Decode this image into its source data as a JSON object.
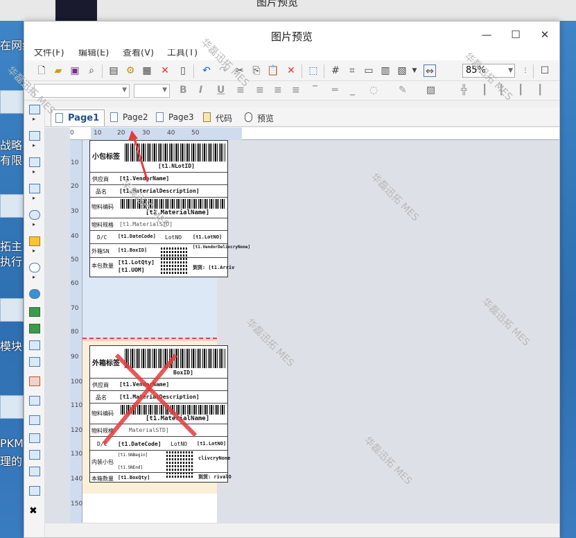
{
  "window": {
    "title": "图片预览",
    "minimize_glyph": "—",
    "maximize_glyph": "☐",
    "close_glyph": "✕"
  },
  "desktop": {
    "behind_title": "图片预览",
    "labels": [
      "在网络",
      "战略",
      "有限",
      "拓主",
      "执行",
      "模块",
      "PKM",
      "理的"
    ]
  },
  "menu": [
    "文件(F)",
    "编辑(E)",
    "查看(V)",
    "工具(T)"
  ],
  "toolbar": {
    "zoom_value": "85%"
  },
  "tabs": [
    {
      "label": "Page1",
      "active": true
    },
    {
      "label": "Page2",
      "active": false
    },
    {
      "label": "Page3",
      "active": false
    },
    {
      "label": "代码",
      "active": false
    },
    {
      "label": "预览",
      "active": false
    }
  ],
  "ruler": {
    "h": [
      "0",
      "10",
      "20",
      "30",
      "40",
      "50"
    ],
    "v": [
      "10",
      "20",
      "30",
      "40",
      "50",
      "60",
      "70",
      "80",
      "90",
      "100",
      "110",
      "120",
      "130",
      "140",
      "150"
    ]
  },
  "label1": {
    "title": "小包标签",
    "lotid_bar": "[t1.NLotID]",
    "vendor_key": "供应商",
    "vendor_val": "[t1.VendorName]",
    "name_key": "品名",
    "name_val": "[t1.MaterialDescription]",
    "code_key": "物料编码",
    "code_val": "[t1.MaterialName]",
    "spec_key": "物料规格",
    "spec_val": "[t1.MaterialSTD]",
    "dc_key": "D/C",
    "dc_val": "[t1.DateCode]",
    "lotno_key": "LotNO",
    "lotno_val": "[t1.LotNO]",
    "sn_key": "外箱SN",
    "sn_val": "[t1.BoxID]",
    "vendor_delivery": "[t1.VendorDelivcryNone]",
    "qty_key": "本包数量",
    "qty_val1": "[t1.LotQty]",
    "qty_val2": "[t1.UOM]",
    "arrive": "到货: [t1.Arriv"
  },
  "label2": {
    "title": "外箱标签",
    "boxid_bar": "BoxID]",
    "vendor_key": "供应商",
    "vendor_val": "[t1.VendorName]",
    "name_key": "品名",
    "name_val": "[t1.MaterialDescription]",
    "code_key": "物料编码",
    "code_val": "[t1.MaterialName]",
    "spec_key": "物料规格",
    "spec_val": "MaterialSTD]",
    "dc_key": "D/C",
    "dc_val": "[t1.DateCode]",
    "lotno_key": "LotNO",
    "lotno_val": "[t1.LotNO]",
    "inner_key": "内装小包",
    "inner_a": "[t1.SNBegin]",
    "inner_b": "[t1.SNEnd]",
    "delivery": "clivcryNone",
    "qty_key": "本箱数量",
    "qty_val": "[t1.BoxQty]",
    "arrive": "到货: rivalO"
  },
  "watermark_text": "华磊迅拓 MES"
}
